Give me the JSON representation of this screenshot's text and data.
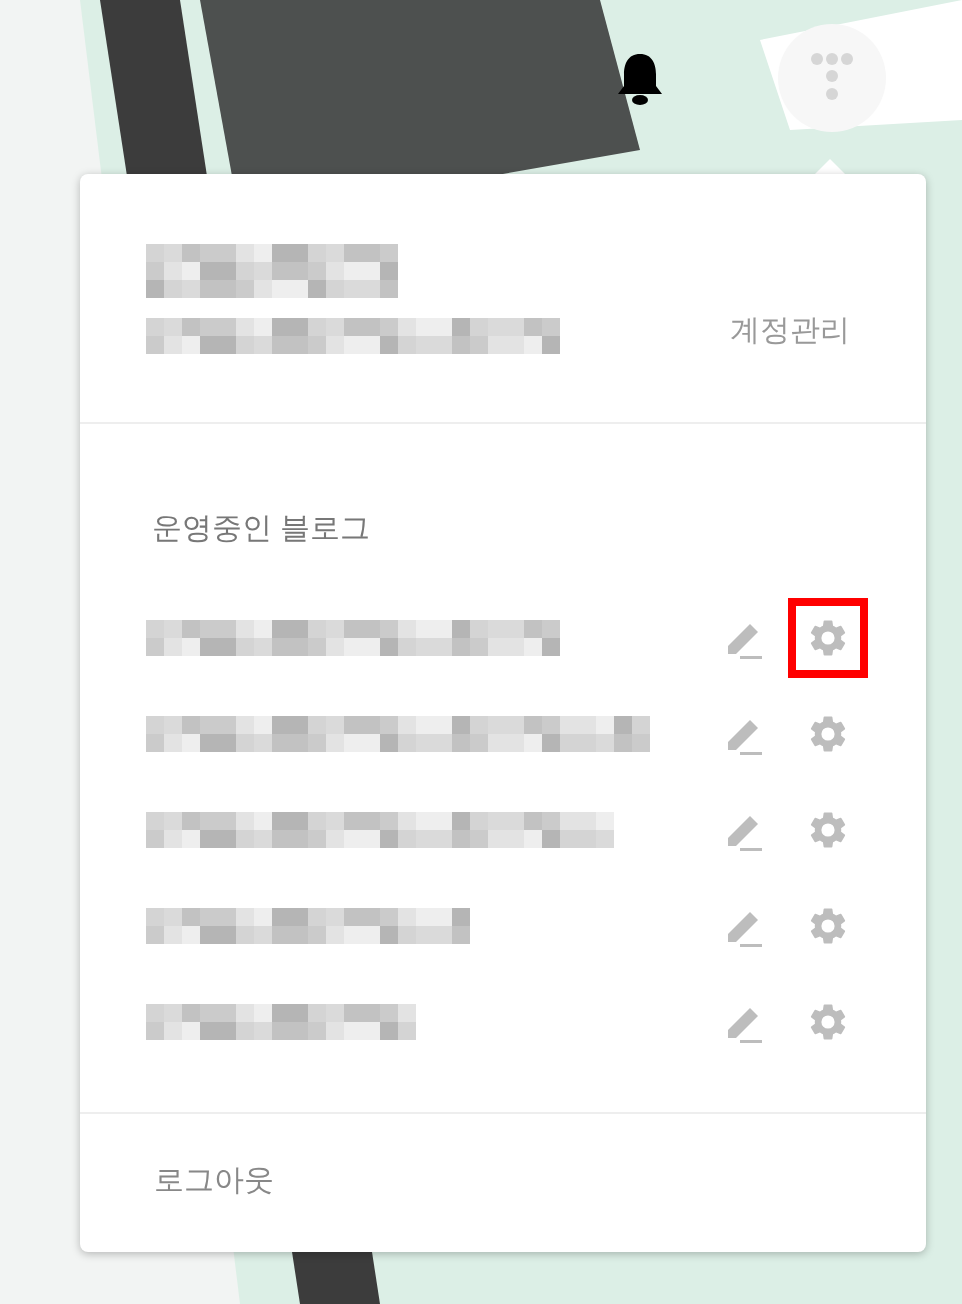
{
  "account_menu": {
    "manage_account": "계정관리",
    "blogs_heading": "운영중인 블로그",
    "blogs": [
      {
        "highlighted": true
      },
      {
        "highlighted": false
      },
      {
        "highlighted": false
      },
      {
        "highlighted": false
      },
      {
        "highlighted": false
      }
    ],
    "logout": "로그아웃"
  }
}
